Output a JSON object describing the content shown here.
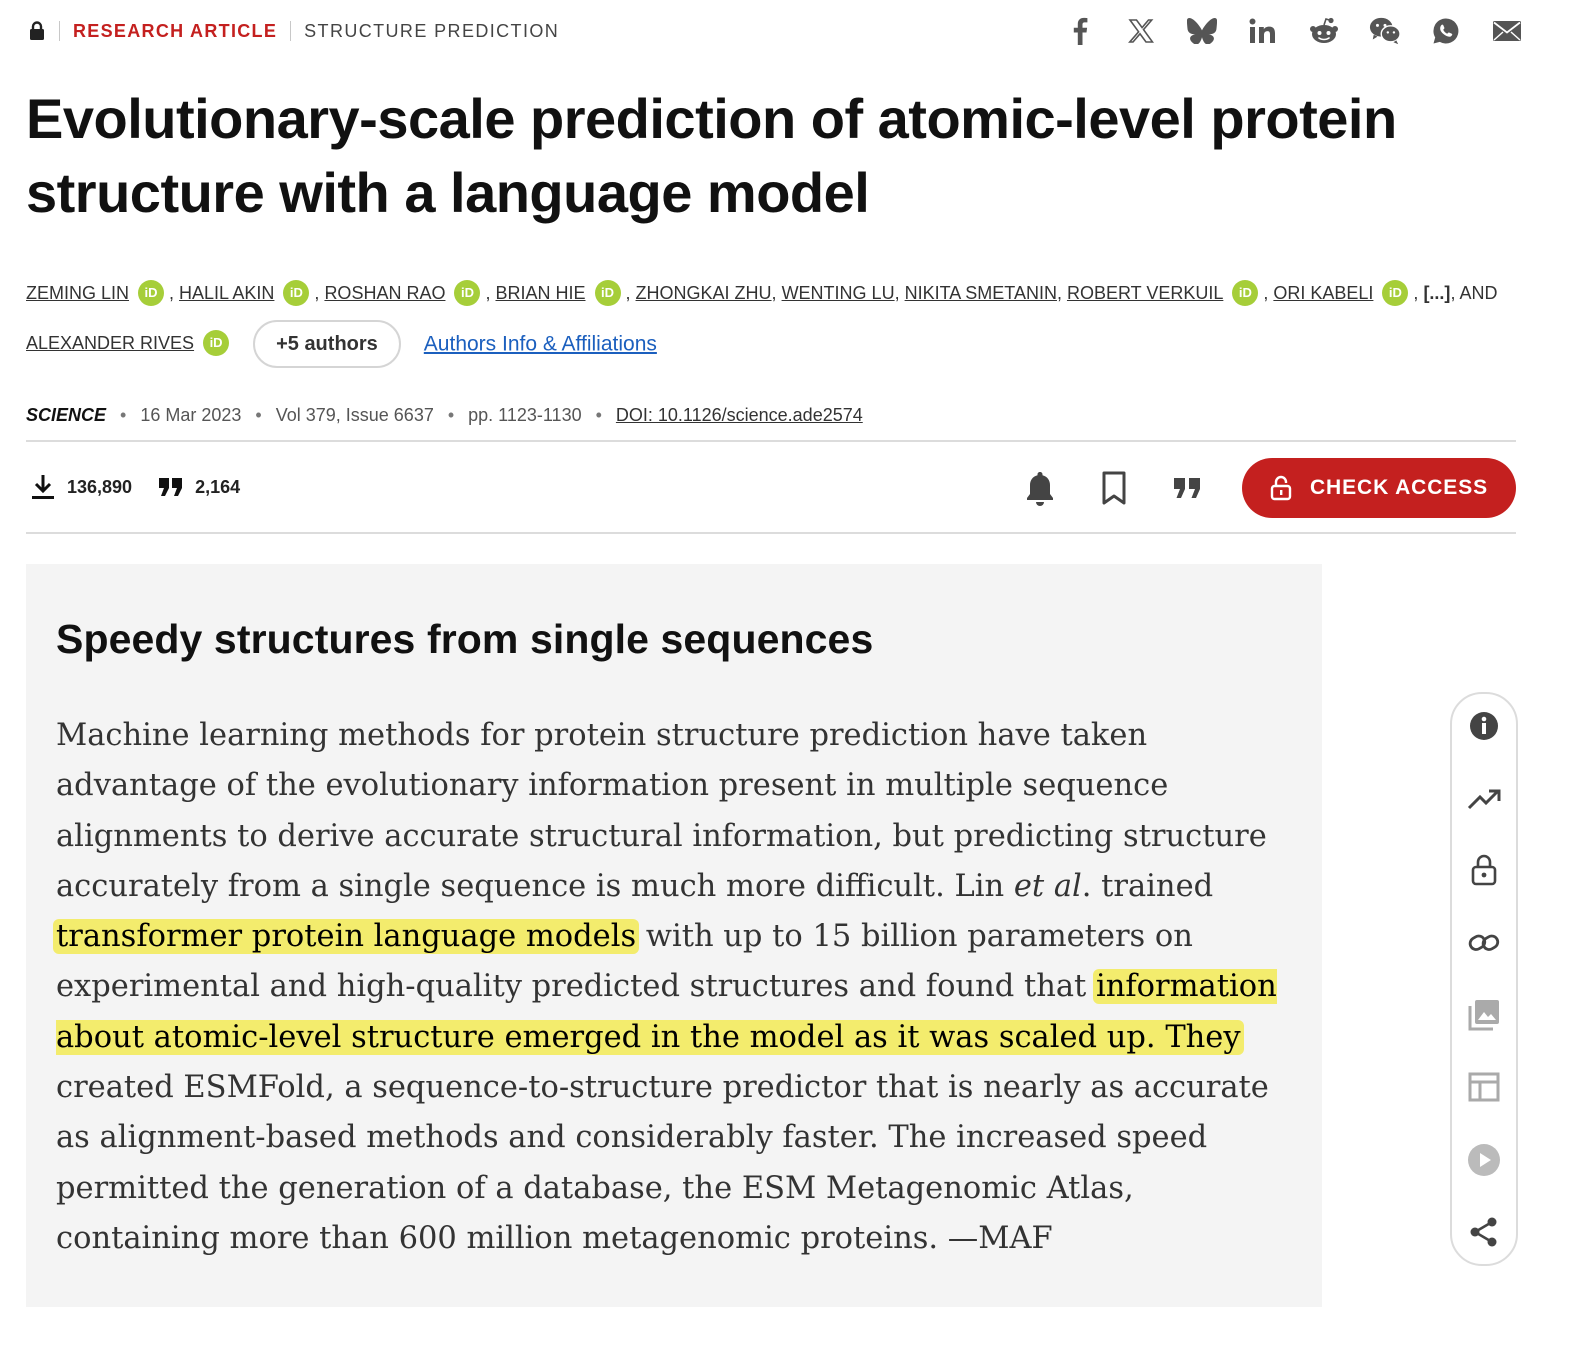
{
  "header": {
    "category_primary": "RESEARCH ARTICLE",
    "category_secondary": "STRUCTURE PREDICTION",
    "share_icons": [
      "facebook-icon",
      "x-icon",
      "bluesky-icon",
      "linkedin-icon",
      "reddit-icon",
      "wechat-icon",
      "whatsapp-icon",
      "email-icon"
    ]
  },
  "article": {
    "title": "Evolutionary-scale prediction of atomic-level protein structure with a language model",
    "authors": [
      "ZEMING LIN",
      "HALIL AKIN",
      "ROSHAN RAO",
      "BRIAN HIE",
      "ZHONGKAI ZHU",
      "WENTING LU",
      "NIKITA SMETANIN",
      "ROBERT VERKUIL",
      "ORI KABELI",
      "ALEXANDER RIVES"
    ],
    "orcid_label": "iD",
    "ellipsis": "[...]",
    "and_text": "AND",
    "more_authors_button": "+5 authors",
    "affiliations_link": "Authors Info & Affiliations"
  },
  "meta": {
    "journal": "SCIENCE",
    "date": "16 Mar 2023",
    "volume_issue": "Vol 379, Issue 6637",
    "pages": "pp. 1123-1130",
    "doi": "DOI: 10.1126/science.ade2574"
  },
  "metrics": {
    "downloads": "136,890",
    "citations": "2,164"
  },
  "actions": {
    "check_access_label": "CHECK ACCESS"
  },
  "summary": {
    "heading": "Speedy structures from single sequences",
    "p1": "Machine learning methods for protein structure prediction have taken advantage of the evolutionary information present in multiple sequence alignments to derive accurate structural information, but predicting structure accurately from a single sequence is much more difficult. Lin ",
    "etal": "et al",
    "p2": ". trained ",
    "hl1": "transformer protein language models",
    "p3": " with up to 15 billion parameters on experimental and high-quality predicted structures and found that ",
    "hl2": "information about atomic-level structure emerged in the model as it was scaled up. They",
    "p4": " created ESMFold, a sequence-to-structure predictor that is nearly as accurate as alignment-based methods and considerably faster. The increased speed permitted the generation of a database, the ESM Metagenomic Atlas, containing more than 600 million metagenomic proteins. —MAF"
  },
  "sidebar_tools": [
    "info-icon",
    "trending-icon",
    "lock-icon",
    "link-icon",
    "images-icon",
    "table-icon",
    "play-icon",
    "share-icon"
  ],
  "colors": {
    "accent_red": "#c4201f",
    "orcid_green": "#a6ce39",
    "highlight_yellow": "#f3ec6d",
    "link_blue": "#1b5fbe",
    "summary_bg": "#f4f4f4"
  }
}
